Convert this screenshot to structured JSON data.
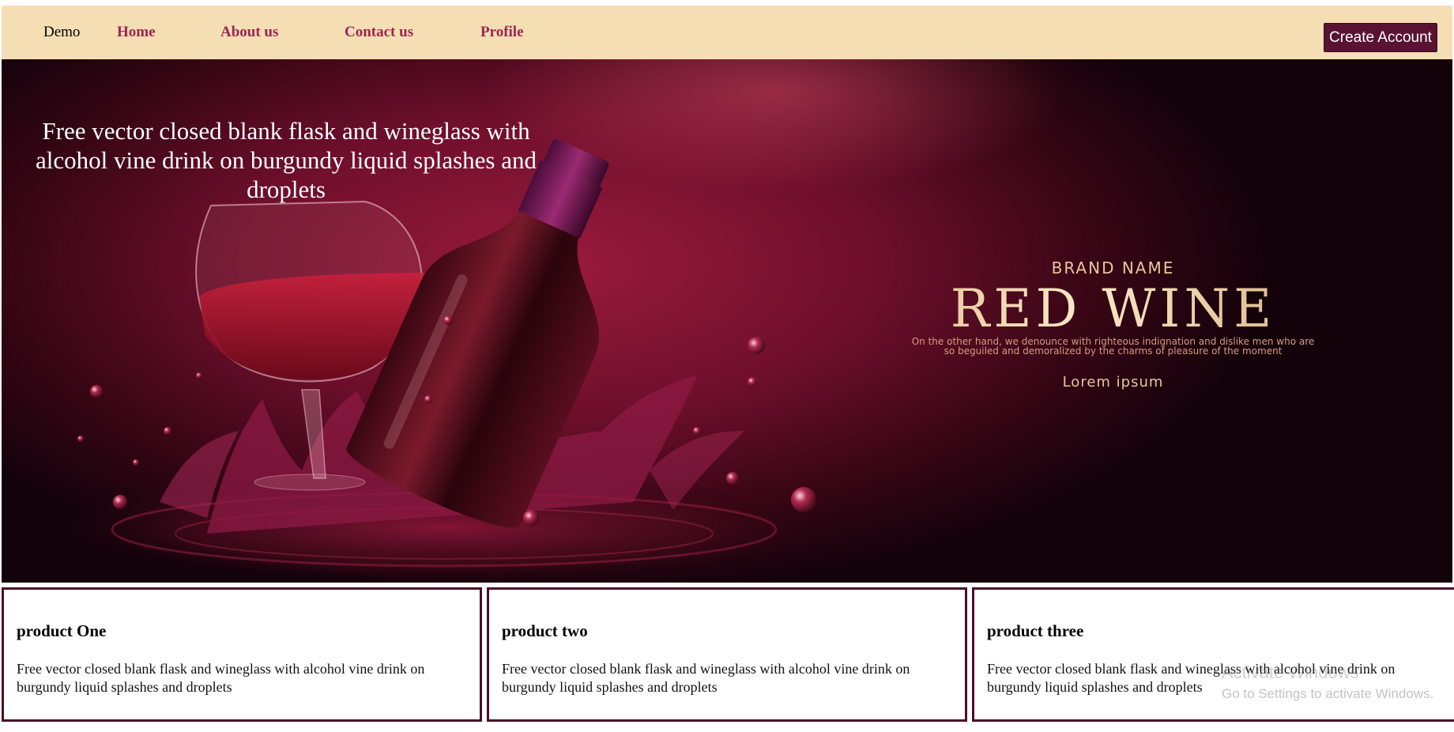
{
  "nav": {
    "brand": "Demo",
    "links": [
      "Home",
      "About us",
      "Contact us",
      "Profile"
    ],
    "create_account": "Create Account"
  },
  "hero": {
    "title": "Free vector closed blank flask and wineglass with alcohol vine drink on burgundy liquid splashes and droplets",
    "brand_name": "BRAND NAME",
    "product_name": "RED WINE",
    "tagline": "On the other hand, we denounce with righteous indignation and dislike men who are so beguiled and demoralized by the charms of pleasure of the moment",
    "lorem": "Lorem ipsum"
  },
  "products": [
    {
      "title": "product One",
      "text": "Free vector closed blank flask and wineglass with alcohol vine drink on burgundy liquid splashes and droplets"
    },
    {
      "title": "product two",
      "text": "Free vector closed blank flask and wineglass with alcohol vine drink on burgundy liquid splashes and droplets"
    },
    {
      "title": "product three",
      "text": "Free vector closed blank flask and wineglass with alcohol vine drink on burgundy liquid splashes and droplets"
    }
  ],
  "watermark": {
    "title": "Activate Windows",
    "subtitle": "Go to Settings to activate Windows."
  },
  "colors": {
    "nav_background": "#f6deb4",
    "nav_link": "#9b2551",
    "button_background": "#5a1233",
    "card_border": "#4a0f28",
    "hero_burgundy": "#6e0f2b"
  }
}
